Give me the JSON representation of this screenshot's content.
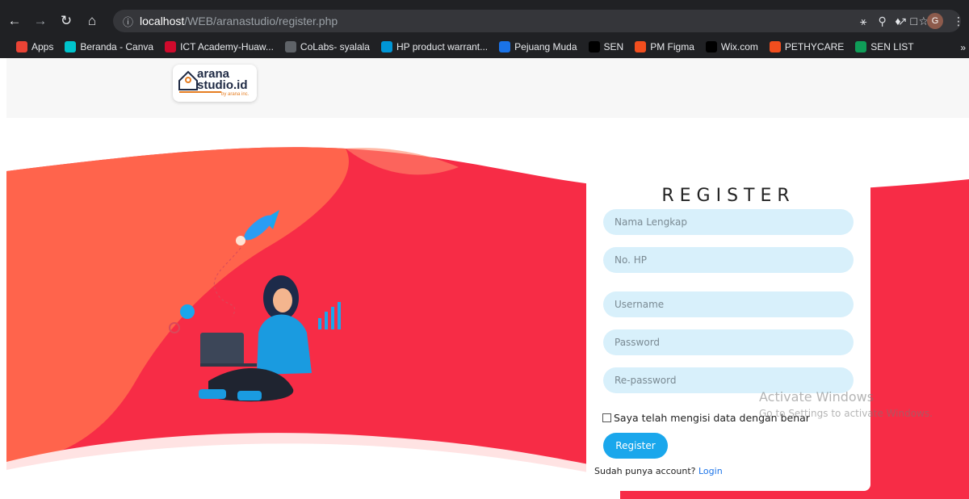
{
  "browser": {
    "url_host": "localhost",
    "url_path": "/WEB/aranastudio/register.php",
    "avatar_letter": "G",
    "bookmarks": [
      {
        "label": "Apps",
        "color": "#ea4335"
      },
      {
        "label": "Beranda - Canva",
        "color": "#00c4cc"
      },
      {
        "label": "ICT Academy-Huaw...",
        "color": "#cf0a2c"
      },
      {
        "label": "CoLabs- syalala",
        "color": "#5f6368"
      },
      {
        "label": "HP product warrant...",
        "color": "#0096d6"
      },
      {
        "label": "Pejuang Muda",
        "color": "#1a73e8"
      },
      {
        "label": "SEN",
        "color": "#000000"
      },
      {
        "label": "PM Figma",
        "color": "#f24e1e"
      },
      {
        "label": "Wix.com",
        "color": "#000000"
      },
      {
        "label": "PETHYCARE",
        "color": "#f24e1e"
      },
      {
        "label": "SEN LIST",
        "color": "#0f9d58"
      }
    ]
  },
  "logo": {
    "line1": "arana",
    "line2": "studio.id",
    "sub": "by arana inc."
  },
  "form": {
    "title": "REGISTER",
    "fields": {
      "name": "Nama Lengkap",
      "phone": "No. HP",
      "username": "Username",
      "password": "Password",
      "repassword": "Re-password"
    },
    "checkbox_label": "Saya telah mengisi data dengan benar",
    "submit_label": "Register",
    "login_prompt": "Sudah punya account? ",
    "login_link": "Login"
  },
  "watermark": {
    "line1": "Activate Windows",
    "line2": "Go to Settings to activate Windows."
  },
  "colors": {
    "wave_red": "#f72c46",
    "wave_orange": "#ff6a4d",
    "input_bg": "#d8f0fb",
    "button": "#1aa7ec"
  }
}
